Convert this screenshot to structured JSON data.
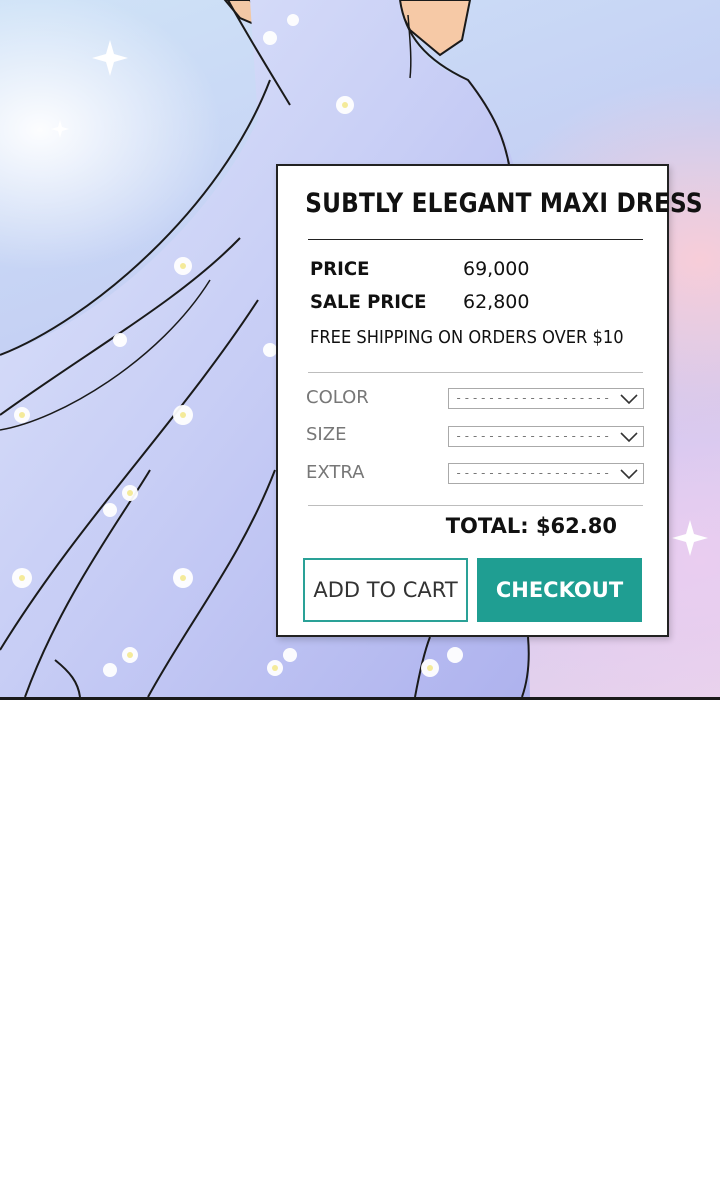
{
  "product": {
    "title": "SUBTLY ELEGANT MAXI DRESS",
    "price_label": "PRICE",
    "price_value": "69,000",
    "sale_label": "SALE PRICE",
    "sale_value": "62,800",
    "shipping_note": "FREE SHIPPING ON ORDERS OVER $10"
  },
  "options": [
    {
      "label": "COLOR",
      "value": "-------------------"
    },
    {
      "label": "SIZE",
      "value": "-------------------"
    },
    {
      "label": "EXTRA",
      "value": "-------------------"
    }
  ],
  "total": "TOTAL: $62.80",
  "buttons": {
    "add_to_cart": "ADD TO CART",
    "checkout": "CHECKOUT"
  },
  "colors": {
    "accent": "#1f9e92",
    "card_border": "#222222",
    "option_text": "#777777"
  },
  "icons": {
    "dropdown": "chevron-down-icon"
  }
}
